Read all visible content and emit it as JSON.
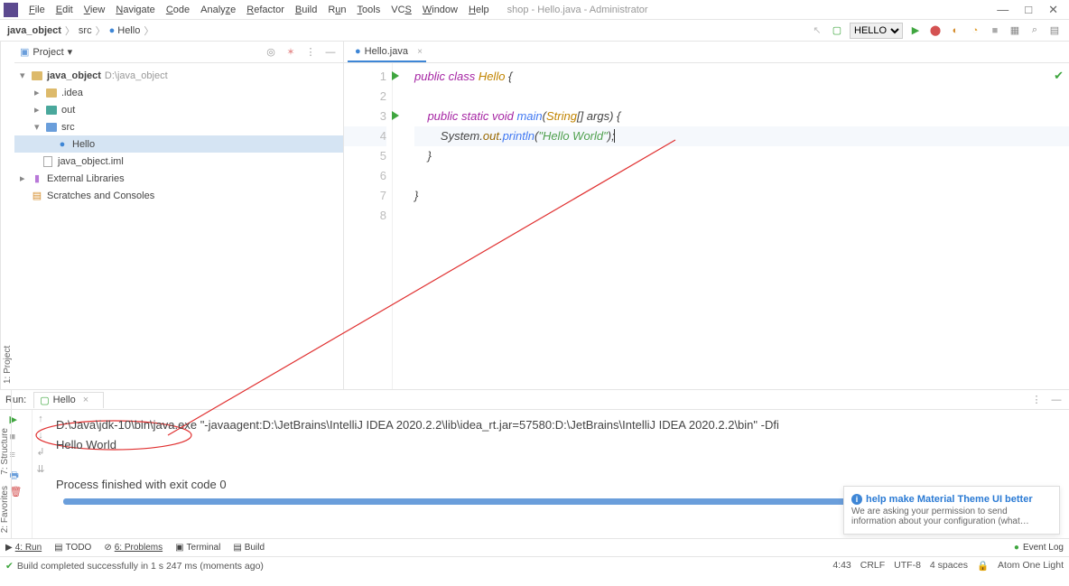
{
  "window": {
    "title": "shop - Hello.java - Administrator",
    "controls": [
      "—",
      "□",
      "✕"
    ]
  },
  "menu": [
    "File",
    "Edit",
    "View",
    "Navigate",
    "Code",
    "Analyze",
    "Refactor",
    "Build",
    "Run",
    "Tools",
    "VCS",
    "Window",
    "Help"
  ],
  "breadcrumb": {
    "items": [
      "java_object",
      "src",
      "Hello"
    ],
    "run_config": "HELLO"
  },
  "project_panel": {
    "title": "Project",
    "root": {
      "label": "java_object",
      "path": "D:\\java_object"
    },
    "idea": ".idea",
    "out": "out",
    "src": "src",
    "hello": "Hello",
    "iml": "java_object.iml",
    "ext": "External Libraries",
    "scratch": "Scratches and Consoles"
  },
  "editor": {
    "tab": "Hello.java",
    "lines": {
      "l1_a": "public class ",
      "l1_b": "Hello",
      "l1_c": " {",
      "l3_a": "    public static void ",
      "l3_b": "main",
      "l3_c": "(",
      "l3_d": "String",
      "l3_e": "[] args) {",
      "l4_a": "        System.",
      "l4_b": "out",
      "l4_c": ".",
      "l4_d": "println",
      "l4_e": "(",
      "l4_f": "\"Hello World\"",
      "l4_g": ");",
      "l5": "    }",
      "l7": "}"
    },
    "gutter": [
      "1",
      "2",
      "3",
      "4",
      "5",
      "6",
      "7",
      "8"
    ]
  },
  "run": {
    "label": "Run:",
    "tab": "Hello",
    "cmd": "D:\\Java\\jdk-10\\bin\\java.exe \"-javaagent:D:\\JetBrains\\IntelliJ IDEA 2020.2.2\\lib\\idea_rt.jar=57580:D:\\JetBrains\\IntelliJ IDEA 2020.2.2\\bin\" -Dfi",
    "out": "Hello World",
    "exit": "Process finished with exit code 0"
  },
  "bottom_tabs": {
    "run": "4: Run",
    "todo": "TODO",
    "problems": "6: Problems",
    "terminal": "Terminal",
    "build": "Build",
    "eventlog": "Event Log"
  },
  "status": {
    "msg": "Build completed successfully in 1 s 247 ms (moments ago)",
    "pos": "4:43",
    "crlf": "CRLF",
    "enc": "UTF-8",
    "indent": "4 spaces",
    "theme": "Atom One Light"
  },
  "notif": {
    "title": "help make Material Theme UI better",
    "text": "We are asking your permission to send information about your configuration (what…"
  },
  "left_rail": {
    "structure": "7: Structure",
    "favorites": "2: Favorites"
  },
  "sidebar_tab": "1: Project"
}
